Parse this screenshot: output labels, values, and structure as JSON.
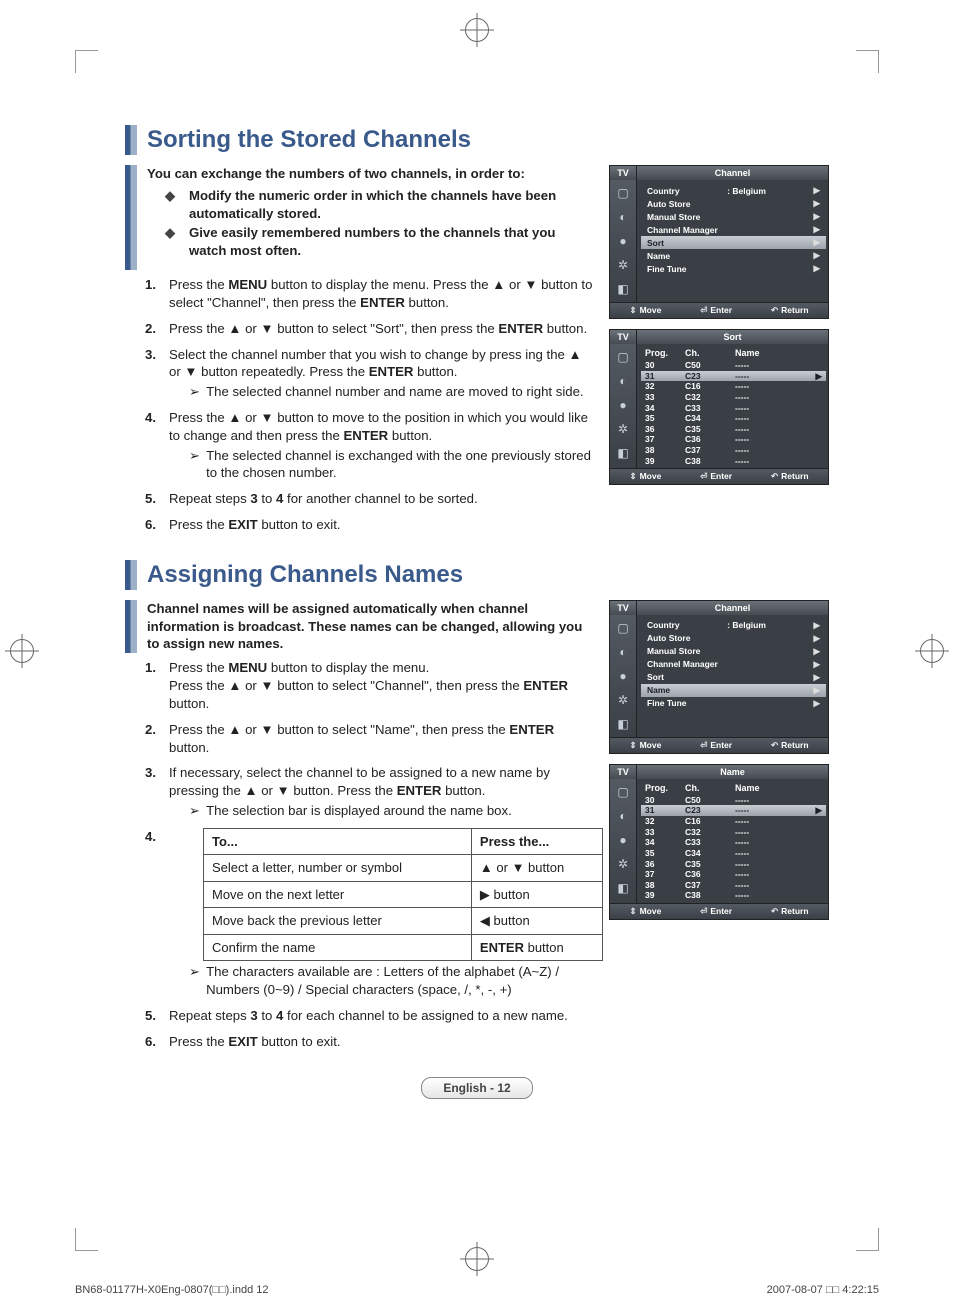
{
  "footer": {
    "file": "BN68-01177H-X0Eng-0807(□□).indd   12",
    "date": "2007-08-07   □□ 4:22:15"
  },
  "page_label": "English - 12",
  "symbols": {
    "up": "▲",
    "down": "▼",
    "left": "◀",
    "right": "▶",
    "updown": "▲ or ▼",
    "note_arrow": "➢"
  },
  "section1": {
    "title": "Sorting the Stored Channels",
    "intro": "You can exchange the numbers of two channels, in order to:",
    "bullets": [
      "Modify the numeric order in which the channels have been automatically stored.",
      "Give easily remembered numbers to the channels that you watch most often."
    ],
    "steps": [
      {
        "num": "1.",
        "html": "Press the <strong>MENU</strong> button to display the menu.  Press the ▲ or ▼ button to select \"Channel\", then press the <strong>ENTER</strong> button."
      },
      {
        "num": "2.",
        "html": "Press the ▲ or ▼ button to select \"Sort\", then press the <strong>ENTER</strong> button."
      },
      {
        "num": "3.",
        "html": "Select the channel number that you wish to change by press ing the ▲ or ▼ button repeatedly. Press the <strong>ENTER</strong> button.",
        "note": "The selected channel number and name are moved to right side."
      },
      {
        "num": "4.",
        "html": "Press the ▲ or ▼ button to move to the position in which you would like to change and then press the <strong>ENTER</strong> button.",
        "note": "The selected channel is exchanged with the one previously stored to the chosen number."
      },
      {
        "num": "5.",
        "html": "Repeat steps <strong>3</strong> to <strong>4</strong> for another channel to be sorted."
      },
      {
        "num": "6.",
        "html": "Press the <strong>EXIT</strong> button to exit."
      }
    ]
  },
  "section2": {
    "title": "Assigning Channels Names",
    "intro": "Channel names will be assigned automatically when channel information is broadcast. These names can be changed, allowing you to assign new names.",
    "steps": [
      {
        "num": "1.",
        "html": "Press the <strong>MENU</strong> button to display the menu.<br>Press the ▲ or ▼ button to select \"Channel\", then press the <strong>ENTER</strong> button."
      },
      {
        "num": "2.",
        "html": "Press the ▲ or ▼ button to select \"Name\", then press the <strong>ENTER</strong> button."
      },
      {
        "num": "3.",
        "html": "If necessary, select the channel to be assigned to a new name by pressing the ▲ or ▼ button. Press the <strong>ENTER</strong> button.",
        "note": "The selection bar is displayed around the name box."
      },
      {
        "num": "4.",
        "table": true,
        "table_headers": [
          "To...",
          "Press the..."
        ],
        "table_rows": [
          [
            "Select a letter, number or symbol",
            "▲ or ▼ button"
          ],
          [
            "Move on the next letter",
            "▶ button"
          ],
          [
            "Move back the previous letter",
            "◀ button"
          ],
          [
            "Confirm the name",
            "<strong>ENTER</strong> button"
          ]
        ],
        "note": "The characters available are : Letters of the alphabet (A~Z) / Numbers (0~9) / Special characters (space, /, *, -, +)"
      },
      {
        "num": "5.",
        "html": "Repeat steps <strong>3</strong> to <strong>4</strong> for each channel to be assigned to a new name."
      },
      {
        "num": "6.",
        "html": "Press the <strong>EXIT</strong> button to exit."
      }
    ]
  },
  "osd_common": {
    "tv": "TV",
    "footer": {
      "move": "Move",
      "enter": "Enter",
      "return": "Return"
    },
    "col_headers": {
      "prog": "Prog.",
      "ch": "Ch.",
      "name": "Name"
    }
  },
  "osd1": {
    "title": "Channel",
    "selected": "Sort",
    "country_value": ": Belgium",
    "items": [
      "Country",
      "Auto Store",
      "Manual Store",
      "Channel Manager",
      "Sort",
      "Name",
      "Fine Tune"
    ]
  },
  "osd2": {
    "title": "Sort",
    "selected_index": 1,
    "rows": [
      [
        "30",
        "C50",
        "-----"
      ],
      [
        "31",
        "C23",
        "-----"
      ],
      [
        "32",
        "C16",
        "-----"
      ],
      [
        "33",
        "C32",
        "-----"
      ],
      [
        "34",
        "C33",
        "-----"
      ],
      [
        "35",
        "C34",
        "-----"
      ],
      [
        "36",
        "C35",
        "-----"
      ],
      [
        "37",
        "C36",
        "-----"
      ],
      [
        "38",
        "C37",
        "-----"
      ],
      [
        "39",
        "C38",
        "-----"
      ]
    ]
  },
  "osd3": {
    "title": "Channel",
    "selected": "Name",
    "country_value": ": Belgium",
    "items": [
      "Country",
      "Auto Store",
      "Manual Store",
      "Channel Manager",
      "Sort",
      "Name",
      "Fine Tune"
    ]
  },
  "osd4": {
    "title": "Name",
    "selected_index": 1,
    "rows": [
      [
        "30",
        "C50",
        "-----"
      ],
      [
        "31",
        "C23",
        "-----"
      ],
      [
        "32",
        "C16",
        "-----"
      ],
      [
        "33",
        "C32",
        "-----"
      ],
      [
        "34",
        "C33",
        "-----"
      ],
      [
        "35",
        "C34",
        "-----"
      ],
      [
        "36",
        "C35",
        "-----"
      ],
      [
        "37",
        "C36",
        "-----"
      ],
      [
        "38",
        "C37",
        "-----"
      ],
      [
        "39",
        "C38",
        "-----"
      ]
    ]
  }
}
